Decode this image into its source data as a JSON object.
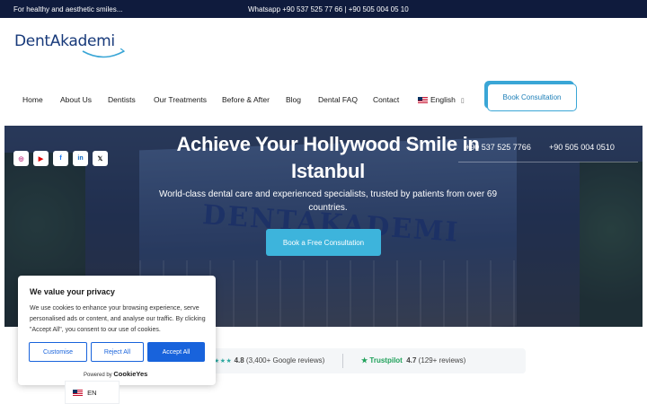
{
  "topbar": {
    "tagline": "For healthy and aesthetic smiles...",
    "contact": "Whatsapp +90 537 525 77 66 | +90 505 004 05 10"
  },
  "header": {
    "logo_text": "DentAkademi",
    "nav": [
      {
        "label": "Home"
      },
      {
        "label": "About Us"
      },
      {
        "label": "Dentists"
      },
      {
        "label": "Our Treatments"
      },
      {
        "label": "Before & After"
      },
      {
        "label": "Blog"
      },
      {
        "label": "Dental FAQ"
      },
      {
        "label": "Contact"
      }
    ],
    "language": "English",
    "cta_label": "Book Consultation"
  },
  "hero": {
    "title": "Achieve Your Hollywood Smile in Istanbul",
    "subtitle": "World-class dental care and experienced specialists, trusted by patients from over 69 countries.",
    "button_label": "Book a Free Consultation",
    "phone_1": "+90 537 525 7766",
    "phone_2": "+90 505 004 0510",
    "sign_text": "DENTAKADEMI",
    "social": [
      "instagram-icon",
      "youtube-icon",
      "facebook-icon",
      "linkedin-icon",
      "x-icon"
    ]
  },
  "ratings": {
    "google_stars": "★★★",
    "google_score": "4.8",
    "google_count": "(3,400+ Google reviews)",
    "trustpilot_label": "★ Trustpilot",
    "trustpilot_score": "4.7",
    "trustpilot_count": "(129+ reviews)"
  },
  "cookie": {
    "title": "We value your privacy",
    "body": "We use cookies to enhance your browsing experience, serve personalised ads or content, and analyse our traffic. By clicking \"Accept All\", you consent to our use of cookies.",
    "customise": "Customise",
    "reject": "Reject All",
    "accept": "Accept All",
    "powered_by": "Powered by",
    "brand": "CookieYes"
  },
  "language_switcher": {
    "code": "EN"
  },
  "colors": {
    "topbar": "#0f1b3d",
    "brand_blue": "#17397a",
    "accent": "#3db4dc",
    "cookie_blue": "#1863dc"
  }
}
